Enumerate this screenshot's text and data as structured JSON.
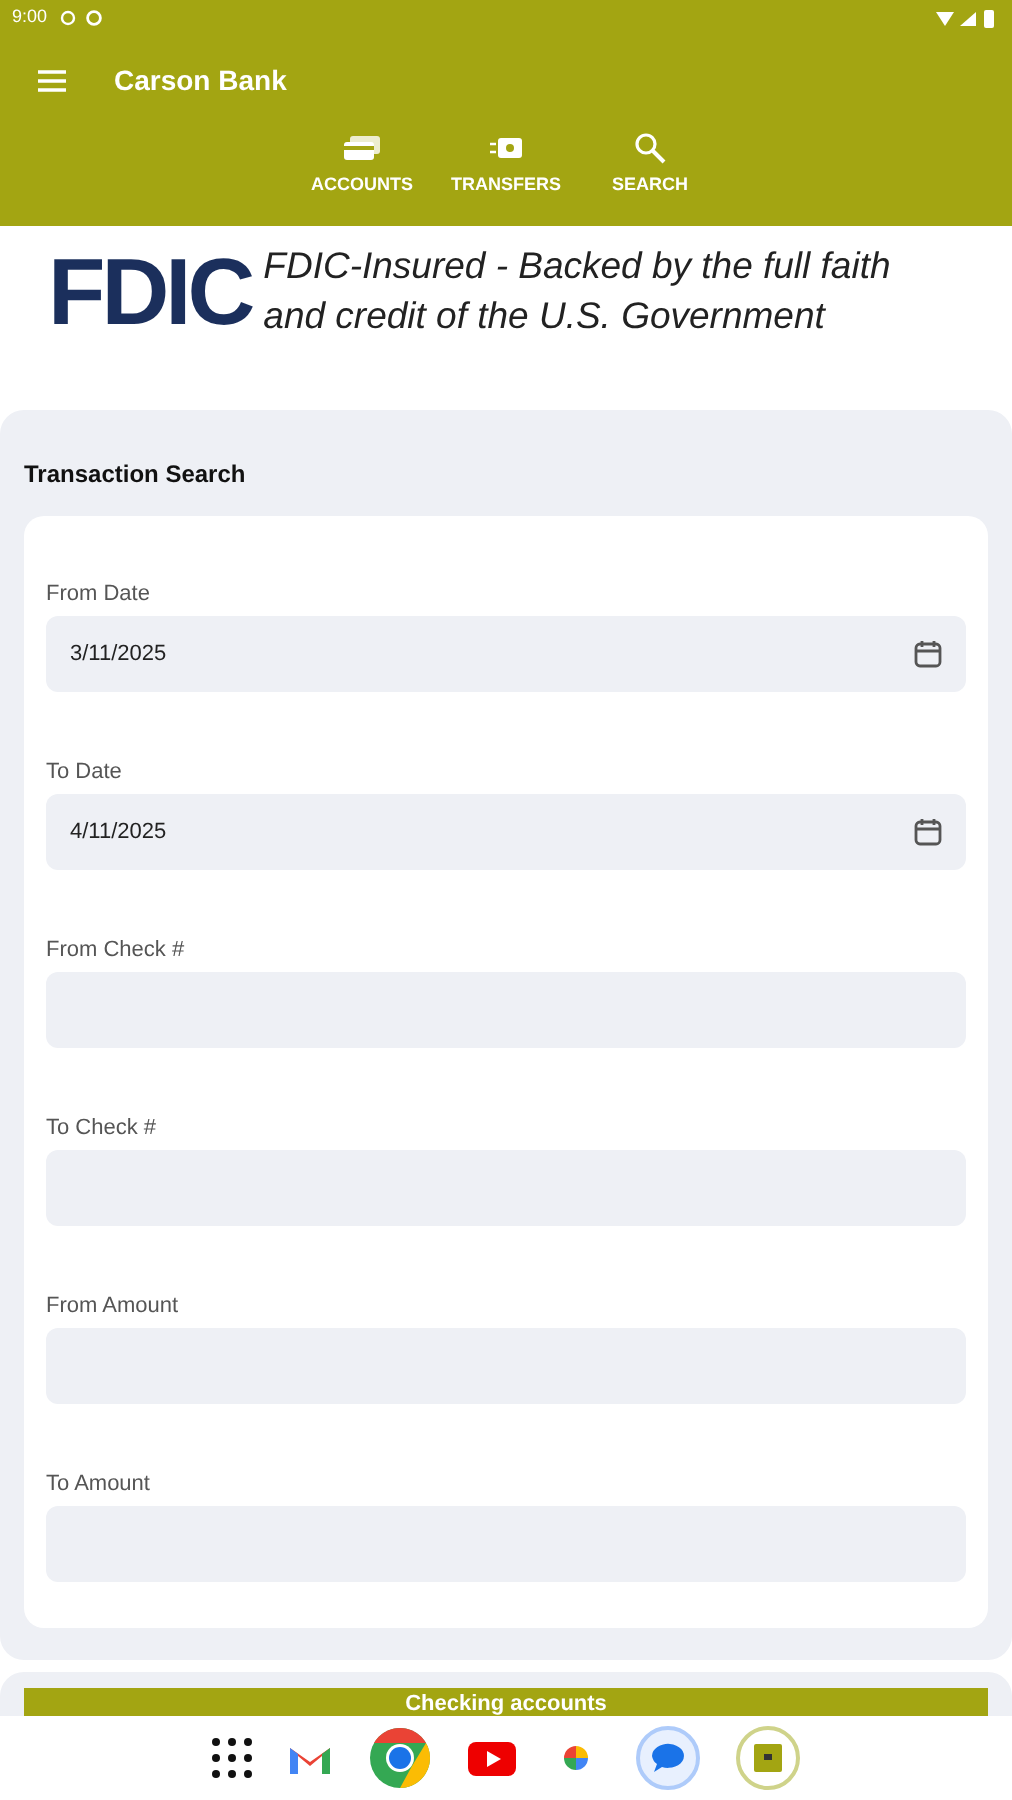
{
  "status_bar": {
    "time": "9:00"
  },
  "app_bar": {
    "title": "Carson Bank"
  },
  "nav": [
    {
      "label": "ACCOUNTS",
      "kind": "accounts"
    },
    {
      "label": "TRANSFERS",
      "kind": "transfers"
    },
    {
      "label": "SEARCH",
      "kind": "search"
    }
  ],
  "banner": {
    "logo": "FDIC",
    "text": "FDIC-Insured - Backed by the full faith and credit of the U.S. Government"
  },
  "search_panel": {
    "title": "Transaction Search",
    "fields": [
      {
        "label": "From Date",
        "value": "3/11/2025",
        "kind": "date"
      },
      {
        "label": "To Date",
        "value": "4/11/2025",
        "kind": "date"
      },
      {
        "label": "From Check #",
        "kind": "text"
      },
      {
        "label": "To Check #",
        "kind": "text"
      },
      {
        "label": "From Amount",
        "kind": "text"
      },
      {
        "label": "To Amount",
        "kind": "text"
      }
    ]
  },
  "accounts_button": {
    "label": "Checking accounts"
  },
  "dock": [
    {
      "kind": "apps"
    },
    {
      "kind": "mail"
    },
    {
      "kind": "browser"
    },
    {
      "kind": "video"
    },
    {
      "kind": "photos"
    },
    {
      "kind": "messages"
    },
    {
      "kind": "bank"
    }
  ]
}
